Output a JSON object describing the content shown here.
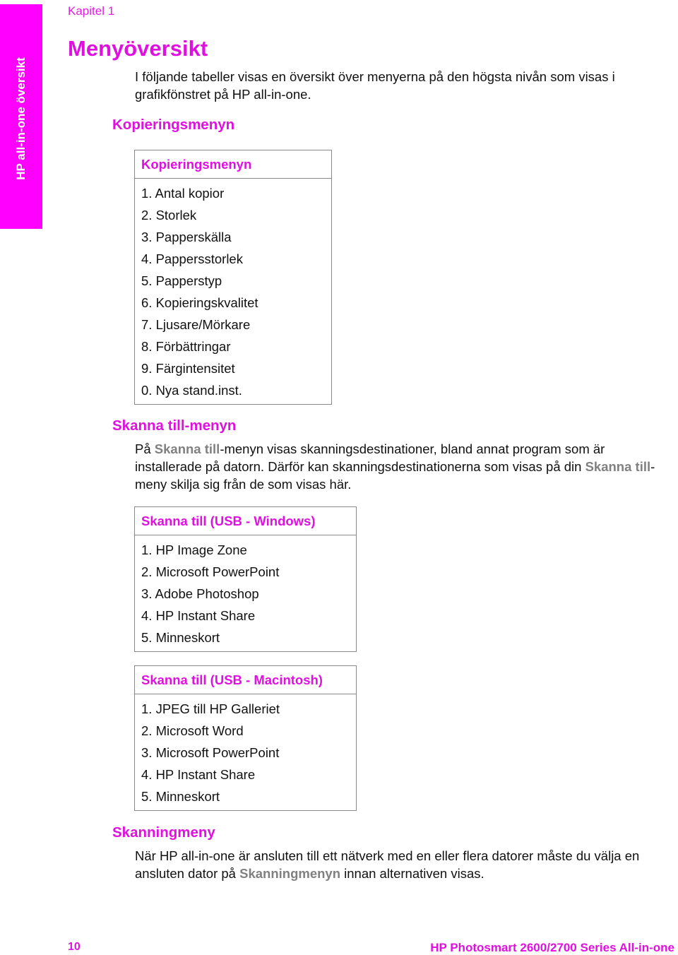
{
  "side_tab": {
    "label": "HP all-in-one översikt"
  },
  "header": {
    "chapter": "Kapitel 1"
  },
  "page_title": "Menyöversikt",
  "intro": "I följande tabeller visas en översikt över menyerna på den högsta nivån som visas i grafikfönstret på HP all-in-one.",
  "sections": {
    "copy": {
      "heading": "Kopieringsmenyn",
      "table": {
        "header": "Kopieringsmenyn",
        "items": [
          "1. Antal kopior",
          "2. Storlek",
          "3. Papperskälla",
          "4. Pappersstorlek",
          "5. Papperstyp",
          "6. Kopieringskvalitet",
          "7. Ljusare/Mörkare",
          "8. Förbättringar",
          "9. Färgintensitet",
          "0. Nya stand.inst."
        ]
      }
    },
    "scan_to": {
      "heading": "Skanna till-menyn",
      "para": {
        "t1": "På ",
        "hl1": "Skanna till",
        "t2": "-menyn visas skanningsdestinationer, bland annat program som är installerade på datorn. Därför kan skanningsdestinationerna som visas på din ",
        "hl2": "Skanna till",
        "t3": "-meny skilja sig från de som visas här."
      },
      "windows_table": {
        "header": "Skanna till (USB - Windows)",
        "items": [
          "1. HP Image Zone",
          "2. Microsoft PowerPoint",
          "3. Adobe Photoshop",
          "4. HP Instant Share",
          "5. Minneskort"
        ]
      },
      "mac_table": {
        "header": "Skanna till (USB - Macintosh)",
        "items": [
          "1. JPEG till HP Galleriet",
          "2. Microsoft Word",
          "3. Microsoft PowerPoint",
          "4. HP Instant Share",
          "5. Minneskort"
        ]
      }
    },
    "scan_menu": {
      "heading": "Skanningmeny",
      "para": {
        "t1": "När HP all-in-one är ansluten till ett nätverk med en eller flera datorer måste du välja en ansluten dator på ",
        "hl1": "Skanningmenyn",
        "t2": " innan alternativen visas."
      }
    }
  },
  "footer": {
    "page_number": "10",
    "product": "HP Photosmart 2600/2700 Series All-in-one"
  },
  "colors": {
    "accent": "#ff00ff",
    "heading": "#e010e0",
    "ui_term": "#808080",
    "text": "#111111"
  }
}
